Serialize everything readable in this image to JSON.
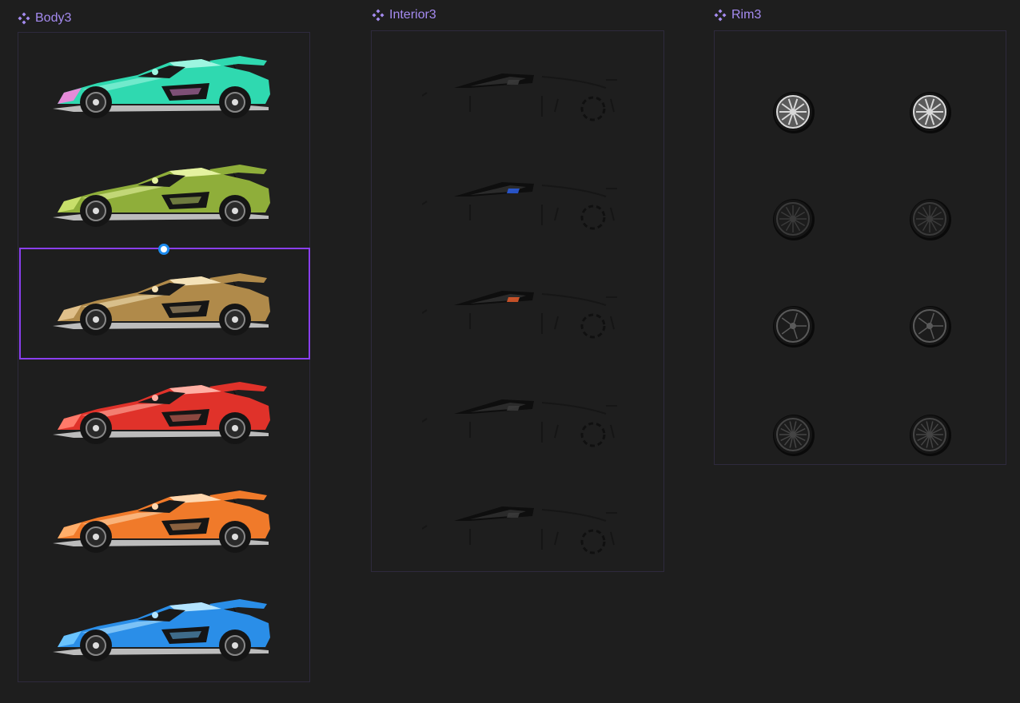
{
  "component_sets": [
    {
      "label": "Body3",
      "variants": [
        {
          "body_color": "#2fd9b0",
          "accent_color": "#e58ad8",
          "highlight_color": "#9ef5e0"
        },
        {
          "body_color": "#8fae3a",
          "accent_color": "#c8df6a",
          "highlight_color": "#e4f2a0"
        },
        {
          "body_color": "#b08a4a",
          "accent_color": "#e0c08a",
          "highlight_color": "#f4e2b8"
        },
        {
          "body_color": "#e0322a",
          "accent_color": "#ff7a6a",
          "highlight_color": "#ffb0a4"
        },
        {
          "body_color": "#f07a2a",
          "accent_color": "#ffae6a",
          "highlight_color": "#ffd8b0"
        },
        {
          "body_color": "#2a8ee8",
          "accent_color": "#6ac4ff",
          "highlight_color": "#b4e4ff"
        }
      ]
    },
    {
      "label": "Interior3",
      "variants": [
        {
          "accent_color": "#3a3a3a"
        },
        {
          "accent_color": "#2a5ad8"
        },
        {
          "accent_color": "#d8582a"
        },
        {
          "accent_color": "#3a3a3a"
        },
        {
          "accent_color": "#3a3a3a"
        }
      ]
    },
    {
      "label": "Rim3",
      "variants": [
        {
          "rim_color": "#d8d8d8"
        },
        {
          "rim_color": "#d8d8d8"
        },
        {
          "rim_color": "#3a3a3a"
        },
        {
          "rim_color": "#3a3a3a"
        },
        {
          "rim_color": "#5a5a5a"
        },
        {
          "rim_color": "#5a5a5a"
        },
        {
          "rim_color": "#444444"
        },
        {
          "rim_color": "#444444"
        }
      ]
    }
  ],
  "selection_color": "#8a3ff0",
  "label_color": "#a58bf0"
}
